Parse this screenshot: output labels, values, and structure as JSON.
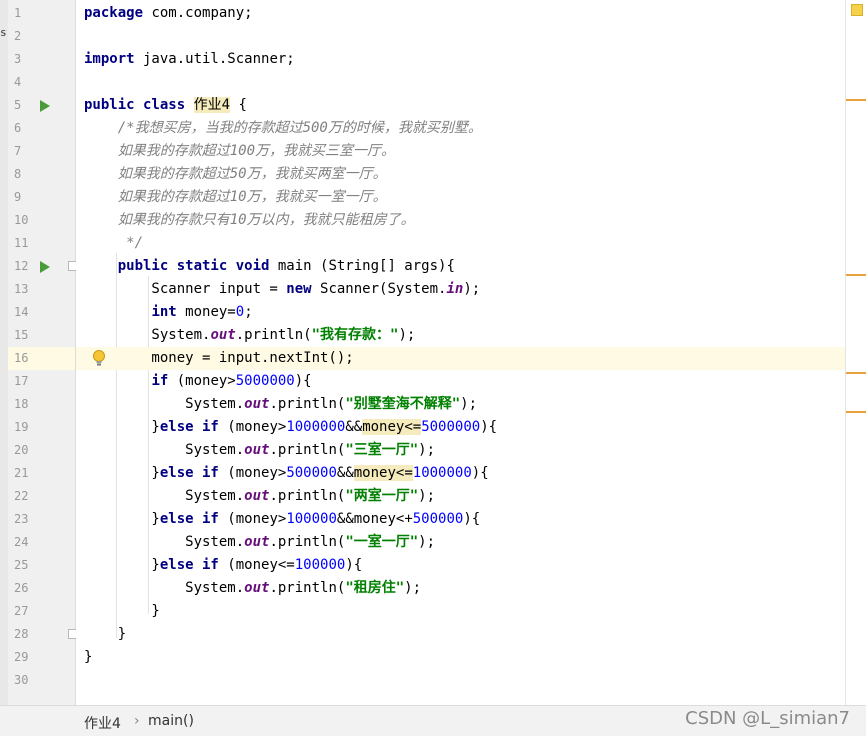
{
  "left_strip": {
    "marks": [
      "s"
    ]
  },
  "gutter": {
    "line_numbers": [
      "1",
      "2",
      "3",
      "4",
      "5",
      "6",
      "7",
      "8",
      "9",
      "10",
      "11",
      "12",
      "13",
      "14",
      "15",
      "16",
      "17",
      "18",
      "19",
      "20",
      "21",
      "22",
      "23",
      "24",
      "25",
      "26",
      "27",
      "28",
      "29",
      "30"
    ]
  },
  "code": {
    "lines": [
      [
        [
          "kw",
          "package"
        ],
        [
          "t",
          " com.company;"
        ]
      ],
      [],
      [
        [
          "kw",
          "import"
        ],
        [
          "t",
          " java.util.Scanner;"
        ]
      ],
      [],
      [
        [
          "kw",
          "public class "
        ],
        [
          "hl",
          "作业4"
        ],
        [
          "t",
          " {"
        ]
      ],
      [
        [
          "cm",
          "    /*我想买房，当我的存款超过500万的时候，我就买别墅。"
        ]
      ],
      [
        [
          "cm",
          "    如果我的存款超过100万，我就买三室一厅。"
        ]
      ],
      [
        [
          "cm",
          "    如果我的存款超过50万，我就买两室一厅。"
        ]
      ],
      [
        [
          "cm",
          "    如果我的存款超过10万，我就买一室一厅。"
        ]
      ],
      [
        [
          "cm",
          "    如果我的存款只有10万以内，我就只能租房了。"
        ]
      ],
      [
        [
          "cm",
          "     */"
        ]
      ],
      [
        [
          "t",
          "    "
        ],
        [
          "kw",
          "public static void"
        ],
        [
          "t",
          " main (String[] args){"
        ]
      ],
      [
        [
          "t",
          "        Scanner input = "
        ],
        [
          "kw",
          "new"
        ],
        [
          "t",
          " Scanner(System."
        ],
        [
          "fld",
          "in"
        ],
        [
          "t",
          ");"
        ]
      ],
      [
        [
          "t",
          "        "
        ],
        [
          "kw",
          "int"
        ],
        [
          "t",
          " money="
        ],
        [
          "num",
          "0"
        ],
        [
          "t",
          ";"
        ]
      ],
      [
        [
          "t",
          "        System."
        ],
        [
          "fld",
          "out"
        ],
        [
          "t",
          ".println("
        ],
        [
          "str",
          "\"我有存款：\""
        ],
        [
          "t",
          ");"
        ]
      ],
      [
        [
          "t",
          "        money = input.nextInt();"
        ]
      ],
      [
        [
          "t",
          "        "
        ],
        [
          "kw",
          "if"
        ],
        [
          "t",
          " (money>"
        ],
        [
          "num",
          "5000000"
        ],
        [
          "t",
          "){"
        ]
      ],
      [
        [
          "t",
          "            System."
        ],
        [
          "fld",
          "out"
        ],
        [
          "t",
          ".println("
        ],
        [
          "str",
          "\"别墅奎海不解释\""
        ],
        [
          "t",
          ");"
        ]
      ],
      [
        [
          "t",
          "        }"
        ],
        [
          "kw",
          "else if"
        ],
        [
          "t",
          " (money>"
        ],
        [
          "num",
          "1000000"
        ],
        [
          "t",
          "&&"
        ],
        [
          "hl",
          "money<="
        ],
        [
          "num",
          "5000000"
        ],
        [
          "t",
          "){"
        ]
      ],
      [
        [
          "t",
          "            System."
        ],
        [
          "fld",
          "out"
        ],
        [
          "t",
          ".println("
        ],
        [
          "str",
          "\"三室一厅\""
        ],
        [
          "t",
          ");"
        ]
      ],
      [
        [
          "t",
          "        }"
        ],
        [
          "kw",
          "else if"
        ],
        [
          "t",
          " (money>"
        ],
        [
          "num",
          "500000"
        ],
        [
          "t",
          "&&"
        ],
        [
          "hl",
          "money<="
        ],
        [
          "num",
          "1000000"
        ],
        [
          "t",
          "){"
        ]
      ],
      [
        [
          "t",
          "            System."
        ],
        [
          "fld",
          "out"
        ],
        [
          "t",
          ".println("
        ],
        [
          "str",
          "\"两室一厅\""
        ],
        [
          "t",
          ");"
        ]
      ],
      [
        [
          "t",
          "        }"
        ],
        [
          "kw",
          "else if"
        ],
        [
          "t",
          " (money>"
        ],
        [
          "num",
          "100000"
        ],
        [
          "t",
          "&&money<+"
        ],
        [
          "num",
          "500000"
        ],
        [
          "t",
          "){"
        ]
      ],
      [
        [
          "t",
          "            System."
        ],
        [
          "fld",
          "out"
        ],
        [
          "t",
          ".println("
        ],
        [
          "str",
          "\"一室一厅\""
        ],
        [
          "t",
          ");"
        ]
      ],
      [
        [
          "t",
          "        }"
        ],
        [
          "kw",
          "else if"
        ],
        [
          "t",
          " (money<="
        ],
        [
          "num",
          "100000"
        ],
        [
          "t",
          "){"
        ]
      ],
      [
        [
          "t",
          "            System."
        ],
        [
          "fld",
          "out"
        ],
        [
          "t",
          ".println("
        ],
        [
          "str",
          "\"租房住\""
        ],
        [
          "t",
          ");"
        ]
      ],
      [
        [
          "t",
          "        }"
        ]
      ],
      [
        [
          "t",
          "    }"
        ]
      ],
      [
        [
          "t",
          "}"
        ]
      ],
      []
    ]
  },
  "current_line": 16,
  "run_icon_lines": [
    5,
    12
  ],
  "fold_icon_lines": [
    12,
    28
  ],
  "bulb_line": 16,
  "icons": {
    "run": "run-gutter-icon",
    "fold": "fold-icon",
    "bulb": "intention-bulb-icon",
    "inspection": "inspection-ok-icon"
  },
  "colors": {
    "keyword": "#000080",
    "comment": "#808080",
    "number": "#0000ff",
    "string": "#008000",
    "field": "#660e7a",
    "current_line": "#fffae3",
    "marker": "#e8a33c"
  },
  "statusbar": {
    "crumb_class": "作业4",
    "crumb_sep": "›",
    "crumb_method": "main()",
    "watermark": "CSDN @L_simian7"
  }
}
